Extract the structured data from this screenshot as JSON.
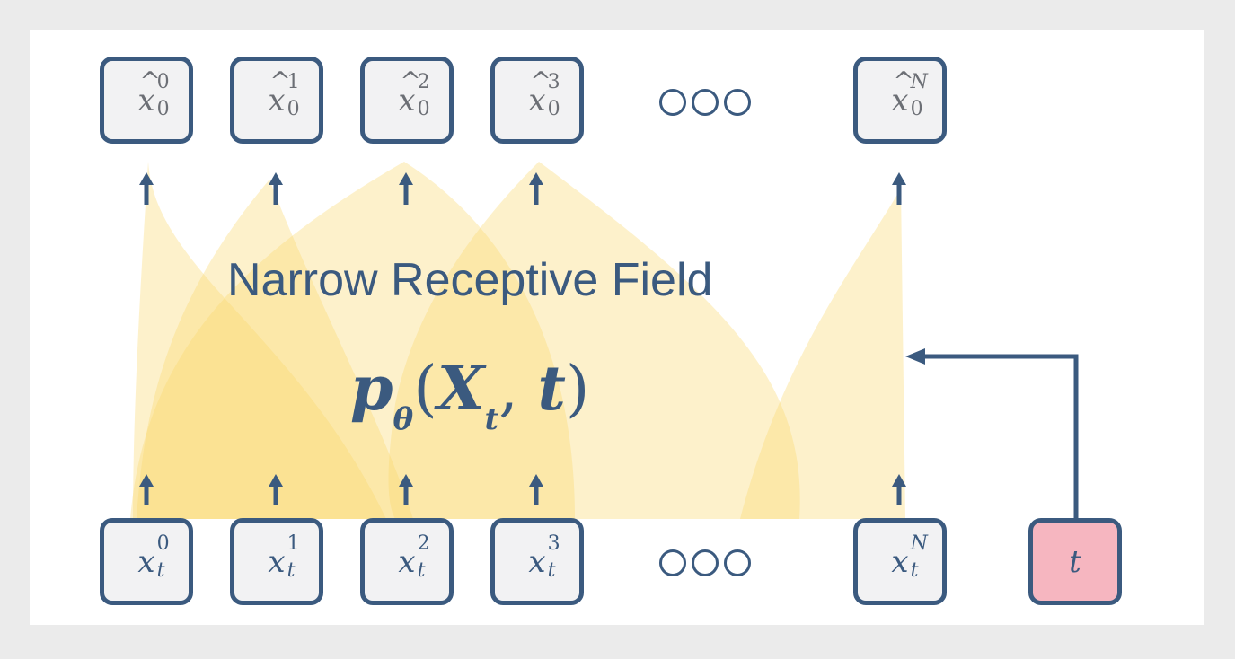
{
  "diagram": {
    "caption": "Narrow Receptive Field",
    "formula": {
      "func": "p",
      "func_sub": "θ",
      "open": "(",
      "arg1": "X",
      "arg1_sub": "t",
      "sep": ", ",
      "arg2": "t",
      "close": ")"
    },
    "outputs": [
      {
        "hat": "^",
        "base": "x",
        "sup": "0",
        "sub": "0"
      },
      {
        "hat": "^",
        "base": "x",
        "sup": "1",
        "sub": "0"
      },
      {
        "hat": "^",
        "base": "x",
        "sup": "2",
        "sub": "0"
      },
      {
        "hat": "^",
        "base": "x",
        "sup": "3",
        "sub": "0"
      },
      {
        "hat": "^",
        "base": "x",
        "sup": "N",
        "sub": "0"
      }
    ],
    "inputs": [
      {
        "base": "x",
        "sup": "0",
        "sub": "t"
      },
      {
        "base": "x",
        "sup": "1",
        "sub": "t"
      },
      {
        "base": "x",
        "sup": "2",
        "sub": "t"
      },
      {
        "base": "x",
        "sup": "3",
        "sub": "t"
      },
      {
        "base": "x",
        "sup": "N",
        "sub": "t"
      }
    ],
    "time_input": "t",
    "colors": {
      "border": "#3b5a7f",
      "node_fill": "#f2f2f3",
      "time_fill": "#f6b6c0",
      "cone": "#f9d66b",
      "background": "#ebebeb"
    }
  }
}
